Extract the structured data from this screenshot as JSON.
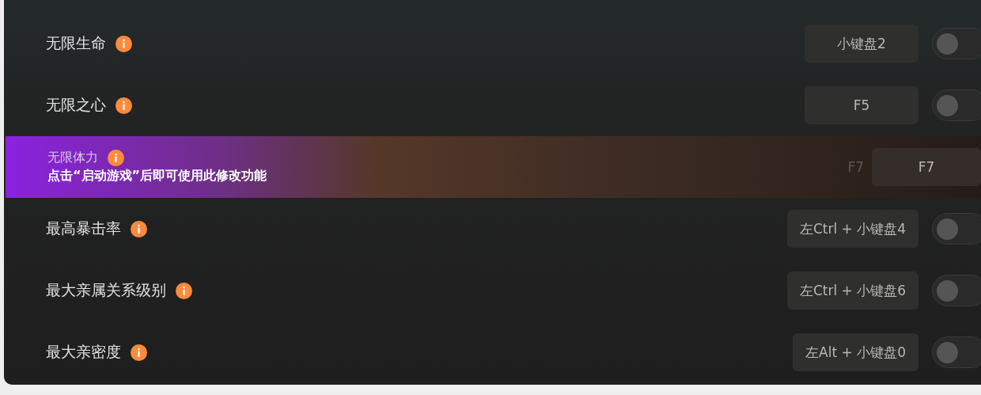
{
  "cheats": [
    {
      "label": "无限生命",
      "hotkey": "小键盘2",
      "hovered": false,
      "on": false
    },
    {
      "label": "无限之心",
      "hotkey": "F5",
      "hovered": false,
      "on": false
    },
    {
      "label": "无限体力",
      "hotkey": "F7",
      "hovered": true,
      "hint": "点击“启动游戏”后即可使用此修改功能",
      "ghost_hotkey": "F7"
    },
    {
      "label": "最高暴击率",
      "hotkey": "左Ctrl + 小键盘4",
      "hovered": false,
      "on": false
    },
    {
      "label": "最大亲属关系级别",
      "hotkey": "左Ctrl + 小键盘6",
      "hovered": false,
      "on": false
    },
    {
      "label": "最大亲密度",
      "hotkey": "左Alt + 小键盘0",
      "hovered": false,
      "on": false
    }
  ]
}
